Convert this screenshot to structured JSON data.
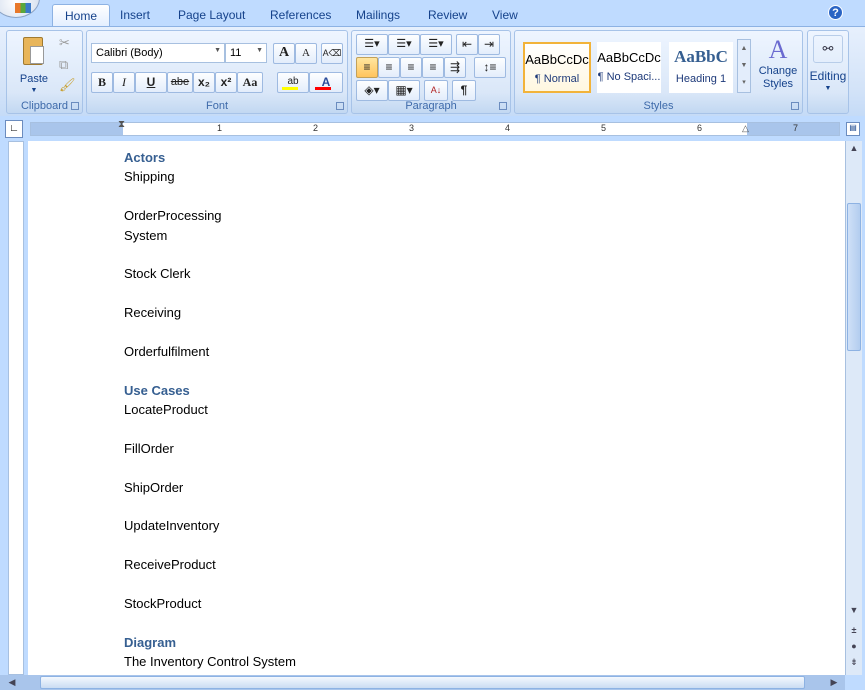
{
  "tabs": [
    "Home",
    "Insert",
    "Page Layout",
    "References",
    "Mailings",
    "Review",
    "View"
  ],
  "active_tab": "Home",
  "clipboard": {
    "label": "Clipboard",
    "paste": "Paste"
  },
  "font": {
    "label": "Font",
    "family": "Calibri (Body)",
    "size": "11",
    "bold": "B",
    "italic": "I",
    "underline": "U",
    "strike": "abe",
    "subscript": "x₂",
    "superscript": "x²",
    "change_case": "Aa",
    "grow": "A",
    "shrink": "A",
    "highlight_color": "#ffff00",
    "font_color": "#ff0000"
  },
  "paragraph": {
    "label": "Paragraph",
    "pilcrow": "¶",
    "sort": "A↓"
  },
  "styles": {
    "label": "Styles",
    "items": [
      {
        "sample": "AaBbCcDc",
        "name": "¶ Normal",
        "selected": true
      },
      {
        "sample": "AaBbCcDc",
        "name": "¶ No Spaci..."
      },
      {
        "sample": "AaBbC",
        "name": "Heading 1"
      }
    ],
    "change_styles": "Change Styles"
  },
  "editing": {
    "label": "Editing"
  },
  "ruler": {
    "numbers": [
      "1",
      "2",
      "3",
      "4",
      "5",
      "6",
      "7"
    ]
  },
  "document": {
    "lines": [
      {
        "text": "Actors",
        "style": "heading"
      },
      {
        "text": "Shipping"
      },
      {
        "text": ""
      },
      {
        "text": "OrderProcessing"
      },
      {
        "text": "System"
      },
      {
        "text": ""
      },
      {
        "text": "Stock Clerk"
      },
      {
        "text": ""
      },
      {
        "text": "Receiving"
      },
      {
        "text": ""
      },
      {
        "text": "Orderfulfilment"
      },
      {
        "text": ""
      },
      {
        "text": "Use Cases",
        "style": "heading"
      },
      {
        "text": "LocateProduct"
      },
      {
        "text": ""
      },
      {
        "text": "FillOrder"
      },
      {
        "text": ""
      },
      {
        "text": "ShipOrder"
      },
      {
        "text": ""
      },
      {
        "text": "UpdateInventory"
      },
      {
        "text": ""
      },
      {
        "text": "ReceiveProduct"
      },
      {
        "text": ""
      },
      {
        "text": "StockProduct"
      },
      {
        "text": ""
      },
      {
        "text": "Diagram",
        "style": "heading"
      },
      {
        "text": "The Inventory Control System"
      }
    ]
  }
}
